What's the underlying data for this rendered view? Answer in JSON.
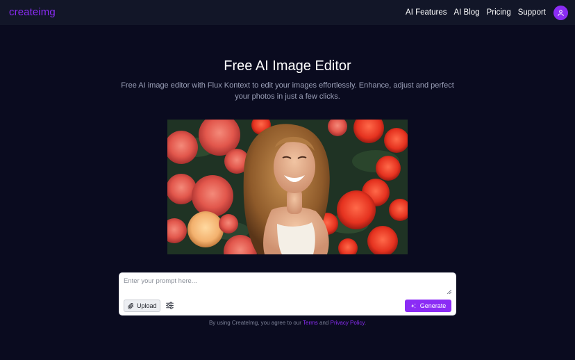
{
  "brand": {
    "logo_text": "createimg",
    "accent": "#8b2cf5"
  },
  "nav": {
    "links": [
      {
        "label": "AI Features"
      },
      {
        "label": "AI Blog"
      },
      {
        "label": "Pricing"
      },
      {
        "label": "Support"
      }
    ],
    "avatar_icon": "user-icon"
  },
  "hero": {
    "title": "Free AI Image Editor",
    "subtitle": "Free AI image editor with Flux Kontext to edit your images effortlessly. Enhance, adjust and perfect your photos in just a few clicks."
  },
  "prompt": {
    "placeholder": "Enter your prompt here...",
    "upload_label": "Upload",
    "upload_icon": "paperclip-icon",
    "settings_icon": "sliders-icon",
    "generate_label": "Generate",
    "generate_icon": "sparkle-icon"
  },
  "terms": {
    "prefix": "By using CreateImg, you agree to our",
    "terms_link": "Terms",
    "and": "and",
    "privacy_link": "Privacy Policy",
    "suffix": "."
  }
}
